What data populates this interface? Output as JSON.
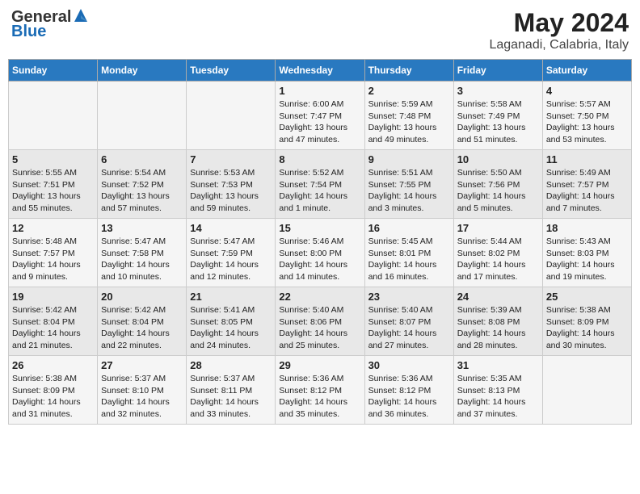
{
  "header": {
    "logo_general": "General",
    "logo_blue": "Blue",
    "main_title": "May 2024",
    "subtitle": "Laganadi, Calabria, Italy"
  },
  "weekdays": [
    "Sunday",
    "Monday",
    "Tuesday",
    "Wednesday",
    "Thursday",
    "Friday",
    "Saturday"
  ],
  "weeks": [
    [
      {
        "day": "",
        "info": ""
      },
      {
        "day": "",
        "info": ""
      },
      {
        "day": "",
        "info": ""
      },
      {
        "day": "1",
        "info": "Sunrise: 6:00 AM\nSunset: 7:47 PM\nDaylight: 13 hours\nand 47 minutes."
      },
      {
        "day": "2",
        "info": "Sunrise: 5:59 AM\nSunset: 7:48 PM\nDaylight: 13 hours\nand 49 minutes."
      },
      {
        "day": "3",
        "info": "Sunrise: 5:58 AM\nSunset: 7:49 PM\nDaylight: 13 hours\nand 51 minutes."
      },
      {
        "day": "4",
        "info": "Sunrise: 5:57 AM\nSunset: 7:50 PM\nDaylight: 13 hours\nand 53 minutes."
      }
    ],
    [
      {
        "day": "5",
        "info": "Sunrise: 5:55 AM\nSunset: 7:51 PM\nDaylight: 13 hours\nand 55 minutes."
      },
      {
        "day": "6",
        "info": "Sunrise: 5:54 AM\nSunset: 7:52 PM\nDaylight: 13 hours\nand 57 minutes."
      },
      {
        "day": "7",
        "info": "Sunrise: 5:53 AM\nSunset: 7:53 PM\nDaylight: 13 hours\nand 59 minutes."
      },
      {
        "day": "8",
        "info": "Sunrise: 5:52 AM\nSunset: 7:54 PM\nDaylight: 14 hours\nand 1 minute."
      },
      {
        "day": "9",
        "info": "Sunrise: 5:51 AM\nSunset: 7:55 PM\nDaylight: 14 hours\nand 3 minutes."
      },
      {
        "day": "10",
        "info": "Sunrise: 5:50 AM\nSunset: 7:56 PM\nDaylight: 14 hours\nand 5 minutes."
      },
      {
        "day": "11",
        "info": "Sunrise: 5:49 AM\nSunset: 7:57 PM\nDaylight: 14 hours\nand 7 minutes."
      }
    ],
    [
      {
        "day": "12",
        "info": "Sunrise: 5:48 AM\nSunset: 7:57 PM\nDaylight: 14 hours\nand 9 minutes."
      },
      {
        "day": "13",
        "info": "Sunrise: 5:47 AM\nSunset: 7:58 PM\nDaylight: 14 hours\nand 10 minutes."
      },
      {
        "day": "14",
        "info": "Sunrise: 5:47 AM\nSunset: 7:59 PM\nDaylight: 14 hours\nand 12 minutes."
      },
      {
        "day": "15",
        "info": "Sunrise: 5:46 AM\nSunset: 8:00 PM\nDaylight: 14 hours\nand 14 minutes."
      },
      {
        "day": "16",
        "info": "Sunrise: 5:45 AM\nSunset: 8:01 PM\nDaylight: 14 hours\nand 16 minutes."
      },
      {
        "day": "17",
        "info": "Sunrise: 5:44 AM\nSunset: 8:02 PM\nDaylight: 14 hours\nand 17 minutes."
      },
      {
        "day": "18",
        "info": "Sunrise: 5:43 AM\nSunset: 8:03 PM\nDaylight: 14 hours\nand 19 minutes."
      }
    ],
    [
      {
        "day": "19",
        "info": "Sunrise: 5:42 AM\nSunset: 8:04 PM\nDaylight: 14 hours\nand 21 minutes."
      },
      {
        "day": "20",
        "info": "Sunrise: 5:42 AM\nSunset: 8:04 PM\nDaylight: 14 hours\nand 22 minutes."
      },
      {
        "day": "21",
        "info": "Sunrise: 5:41 AM\nSunset: 8:05 PM\nDaylight: 14 hours\nand 24 minutes."
      },
      {
        "day": "22",
        "info": "Sunrise: 5:40 AM\nSunset: 8:06 PM\nDaylight: 14 hours\nand 25 minutes."
      },
      {
        "day": "23",
        "info": "Sunrise: 5:40 AM\nSunset: 8:07 PM\nDaylight: 14 hours\nand 27 minutes."
      },
      {
        "day": "24",
        "info": "Sunrise: 5:39 AM\nSunset: 8:08 PM\nDaylight: 14 hours\nand 28 minutes."
      },
      {
        "day": "25",
        "info": "Sunrise: 5:38 AM\nSunset: 8:09 PM\nDaylight: 14 hours\nand 30 minutes."
      }
    ],
    [
      {
        "day": "26",
        "info": "Sunrise: 5:38 AM\nSunset: 8:09 PM\nDaylight: 14 hours\nand 31 minutes."
      },
      {
        "day": "27",
        "info": "Sunrise: 5:37 AM\nSunset: 8:10 PM\nDaylight: 14 hours\nand 32 minutes."
      },
      {
        "day": "28",
        "info": "Sunrise: 5:37 AM\nSunset: 8:11 PM\nDaylight: 14 hours\nand 33 minutes."
      },
      {
        "day": "29",
        "info": "Sunrise: 5:36 AM\nSunset: 8:12 PM\nDaylight: 14 hours\nand 35 minutes."
      },
      {
        "day": "30",
        "info": "Sunrise: 5:36 AM\nSunset: 8:12 PM\nDaylight: 14 hours\nand 36 minutes."
      },
      {
        "day": "31",
        "info": "Sunrise: 5:35 AM\nSunset: 8:13 PM\nDaylight: 14 hours\nand 37 minutes."
      },
      {
        "day": "",
        "info": ""
      }
    ]
  ]
}
